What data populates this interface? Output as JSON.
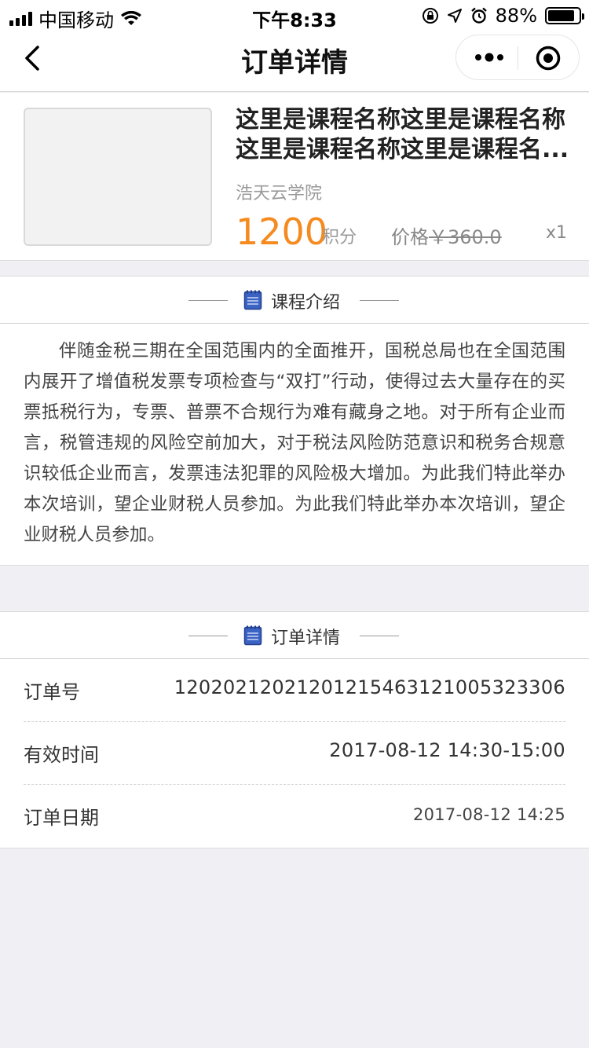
{
  "status_bar": {
    "carrier": "中国移动",
    "time": "下午8:33",
    "battery": "88%",
    "battery_level": 0.88,
    "icons": [
      "signal-icon",
      "wifi-icon",
      "lock-rotation-icon",
      "location-icon",
      "alarm-icon",
      "battery-icon"
    ]
  },
  "nav": {
    "title": "订单详情",
    "back_icon": "chevron-left-icon",
    "more_icon": "more-dots-icon",
    "close_icon": "target-circle-icon"
  },
  "product": {
    "name_line1": "这里是课程名称这里是课程名称",
    "name_line2": "这里是课程名称这里是课程名...",
    "school": "浩天云学院",
    "points": "1200",
    "points_unit": "积分",
    "price_label": "价格",
    "price_value": "￥360.0",
    "quantity": "x1"
  },
  "intro": {
    "heading": "课程介绍",
    "text": "伴随金税三期在全国范围内的全面推开，国税总局也在全国范围内展开了增值税发票专项检查与“双打”行动，使得过去大量存在的买票抵税行为，专票、普票不合规行为难有藏身之地。对于所有企业而言，税管违规的风险空前加大，对于税法风险防范意识和税务合规意识较低企业而言，发票违法犯罪的风险极大增加。为此我们特此举办本次培训，望企业财税人员参加。为此我们特此举办本次培训，望企业财税人员参加。"
  },
  "order": {
    "heading": "订单详情",
    "rows": [
      {
        "label": "订单号",
        "value": "12020212021201215463121005323306"
      },
      {
        "label": "有效时间",
        "value": "2017-08-12 14:30-15:00"
      },
      {
        "label": "订单日期",
        "value": "2017-08-12 14:25"
      }
    ]
  },
  "colors": {
    "accent_orange": "#f58a1f",
    "section_icon_blue": "#3b63c4",
    "background": "#efeff4"
  }
}
